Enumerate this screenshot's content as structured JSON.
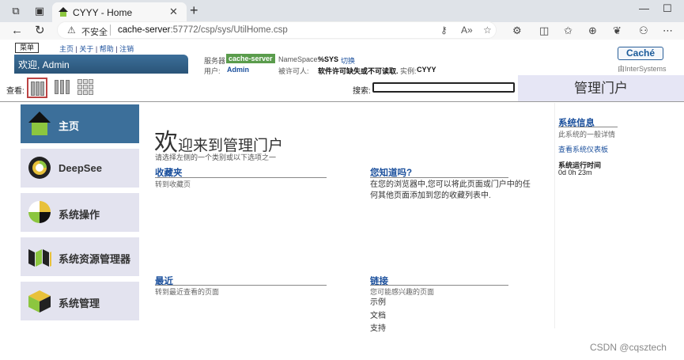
{
  "browser": {
    "tab_title": "CYYY - Home",
    "insecure_label": "不安全",
    "url_host": "cache-server",
    "url_path": ":57772/csp/sys/UtilHome.csp"
  },
  "header": {
    "menu_tab": "菜单",
    "links": [
      "主页",
      "关于",
      "帮助",
      "注销"
    ],
    "welcome": "欢迎, Admin",
    "server_label": "服务器",
    "server_value": "cache-server",
    "namespace_label": "NameSpace:",
    "namespace_value": "%SYS",
    "switch_link": "切换",
    "user_label": "用户:",
    "user_value": "Admin",
    "licensee_label": "被许可人:",
    "licensee_value": "软件许可缺失或不可读取.",
    "instance_label": "实例:",
    "instance_value": "CYYY",
    "brand": "Caché",
    "brand_by": "由InterSystems"
  },
  "toolbar": {
    "view_label": "查看:",
    "search_label": "搜索:",
    "search_value": "",
    "portal_title": "管理门户"
  },
  "sidebar": {
    "items": [
      {
        "label": "主页",
        "icon": "home-icon"
      },
      {
        "label": "DeepSee",
        "icon": "deepsee-icon"
      },
      {
        "label": "系统操作",
        "icon": "pie-chart-icon"
      },
      {
        "label": "系统资源管理器",
        "icon": "explorer-icon"
      },
      {
        "label": "系统管理",
        "icon": "cube-icon"
      }
    ]
  },
  "main": {
    "welcome_big": "欢",
    "welcome_rest": "迎来到管理门户",
    "subtitle": "请选择左侧的一个类别或以下选项之一",
    "favorites": {
      "title": "收藏夹",
      "sub": "转到收藏页"
    },
    "didyouknow": {
      "title": "您知道吗?",
      "text1": "在您的浏览器中,您可以将此页面或门户中的任",
      "text2": "何其他页面添加到您的收藏列表中."
    },
    "recent": {
      "title": "最近",
      "sub": "转到最近查看的页面"
    },
    "links": {
      "title": "链接",
      "sub": "您可能感兴趣的页面",
      "items": [
        "示例",
        "文档",
        "支持"
      ]
    }
  },
  "right": {
    "title": "系统信息",
    "sub": "此系统的一般详情",
    "dashboard_link": "查看系统仪表板",
    "uptime_label": "系统运行时间",
    "uptime_value": "0d 0h 23m"
  },
  "watermark": "CSDN @cqsztech"
}
